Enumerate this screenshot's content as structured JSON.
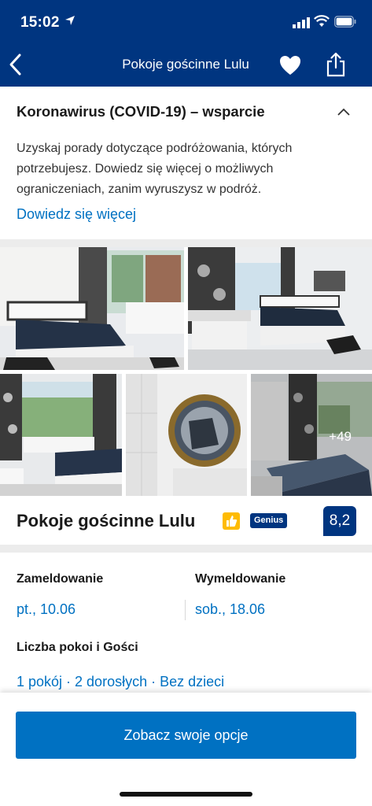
{
  "status_bar": {
    "time": "15:02"
  },
  "nav": {
    "title": "Pokoje gościnne Lulu"
  },
  "covid": {
    "heading": "Koronawirus (COVID-19) – wsparcie",
    "body": "Uzyskaj porady dotyczące podróżowania, których potrzebujesz. Dowiedz się więcej o możliwych ograniczeniach, zanim wyruszysz w podróż.",
    "link": "Dowiedz się więcej"
  },
  "gallery": {
    "more_count": "+49"
  },
  "property": {
    "name": "Pokoje gościnne Lulu",
    "genius_badge": "Genius",
    "score": "8,2"
  },
  "booking": {
    "checkin_label": "Zameldowanie",
    "checkin_value": "pt., 10.06",
    "checkout_label": "Wymeldowanie",
    "checkout_value": "sob., 18.06",
    "rooms_label": "Liczba pokoi i Gości",
    "rooms_value": "1 pokój · 2 dorosłych · Bez dzieci"
  },
  "footer": {
    "cta_label": "Zobacz swoje opcje"
  },
  "colors": {
    "brand": "#003580",
    "accent": "#0071c2",
    "badge_yellow": "#febb02"
  },
  "icons": [
    "location-arrow-icon",
    "signal-icon",
    "wifi-icon",
    "battery-icon",
    "back-arrow-icon",
    "heart-icon",
    "share-icon",
    "chevron-up-icon",
    "thumbs-up-icon"
  ]
}
